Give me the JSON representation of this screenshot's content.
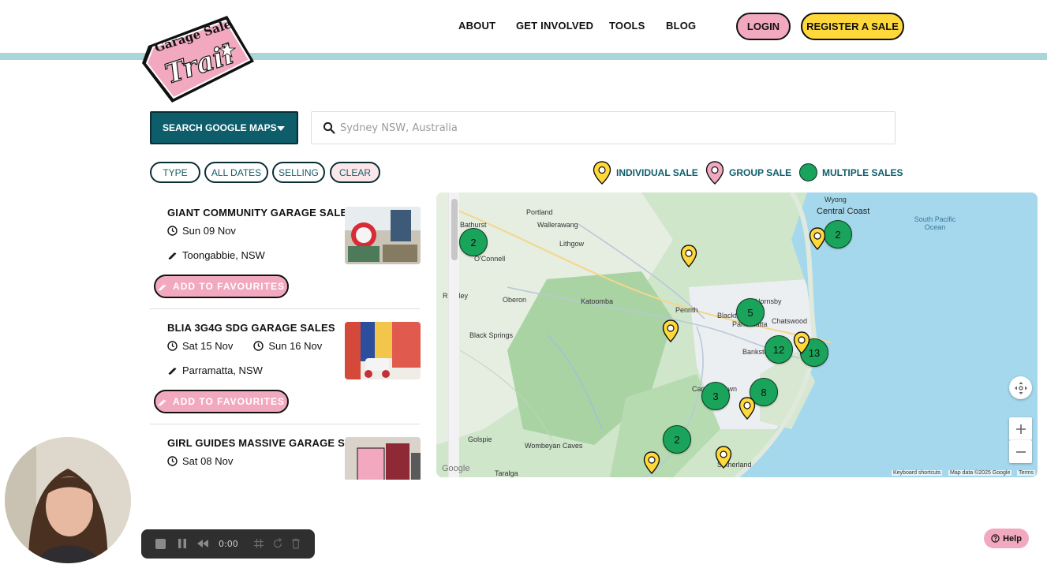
{
  "brand": {
    "logo_top": "Garage Sale",
    "logo_bottom": "Trail"
  },
  "nav": {
    "about": "ABOUT",
    "get_involved": "GET INVOLVED",
    "tools": "TOOLS",
    "blog": "BLOG",
    "login": "LOGIN",
    "register": "REGISTER A SALE"
  },
  "search": {
    "mode_label": "SEARCH GOOGLE MAPS",
    "placeholder": "Sydney NSW, Australia"
  },
  "filters": {
    "type": "TYPE",
    "all_dates": "ALL DATES",
    "selling": "SELLING",
    "clear": "CLEAR"
  },
  "legend": {
    "individual": "INDIVIDUAL SALE",
    "group": "GROUP SALE",
    "multiple": "MULTIPLE SALES"
  },
  "listings": [
    {
      "title": "GIANT COMMUNITY GARAGE SALE",
      "dates": [
        "Sun 09 Nov"
      ],
      "location": "Toongabbie, NSW",
      "fav_label": "ADD TO FAVOURITES"
    },
    {
      "title": "BLIA 3G4G SDG GARAGE SALES",
      "dates": [
        "Sat 15 Nov",
        "Sun 16 Nov"
      ],
      "location": "Parramatta, NSW",
      "fav_label": "ADD TO FAVOURITES"
    },
    {
      "title": "GIRL GUIDES MASSIVE GARAGE SALE",
      "dates": [
        "Sat 08 Nov"
      ],
      "location": "",
      "fav_label": ""
    }
  ],
  "map": {
    "labels": [
      "Bathurst",
      "Portland",
      "Wallerawang",
      "Lithgow",
      "O'Connell",
      "Rockley",
      "Oberon",
      "Katoomba",
      "Penrith",
      "Hornsby",
      "Blacktown",
      "Parramatta",
      "Chatswood",
      "Bankstown",
      "Black Springs",
      "Campbelltown",
      "Golspie",
      "Wombeyan Caves",
      "Taralga",
      "Wyong",
      "Central Coast",
      "Sutherland"
    ],
    "sea_label": "South Pacific Ocean",
    "clusters": [
      "2",
      "2",
      "5",
      "12",
      "13",
      "8",
      "3",
      "2"
    ],
    "footer": {
      "shortcuts": "Keyboard shortcuts",
      "data": "Map data ©2025 Google",
      "terms": "Terms"
    },
    "attribution": "Google"
  },
  "recorder": {
    "time": "0:00"
  },
  "help": {
    "label": "Help"
  },
  "colors": {
    "teal": "#0d5d6b",
    "pink": "#f2a9c0",
    "yellow": "#ffd83a",
    "green": "#1aa35a",
    "stripe": "#a9d6d9"
  }
}
